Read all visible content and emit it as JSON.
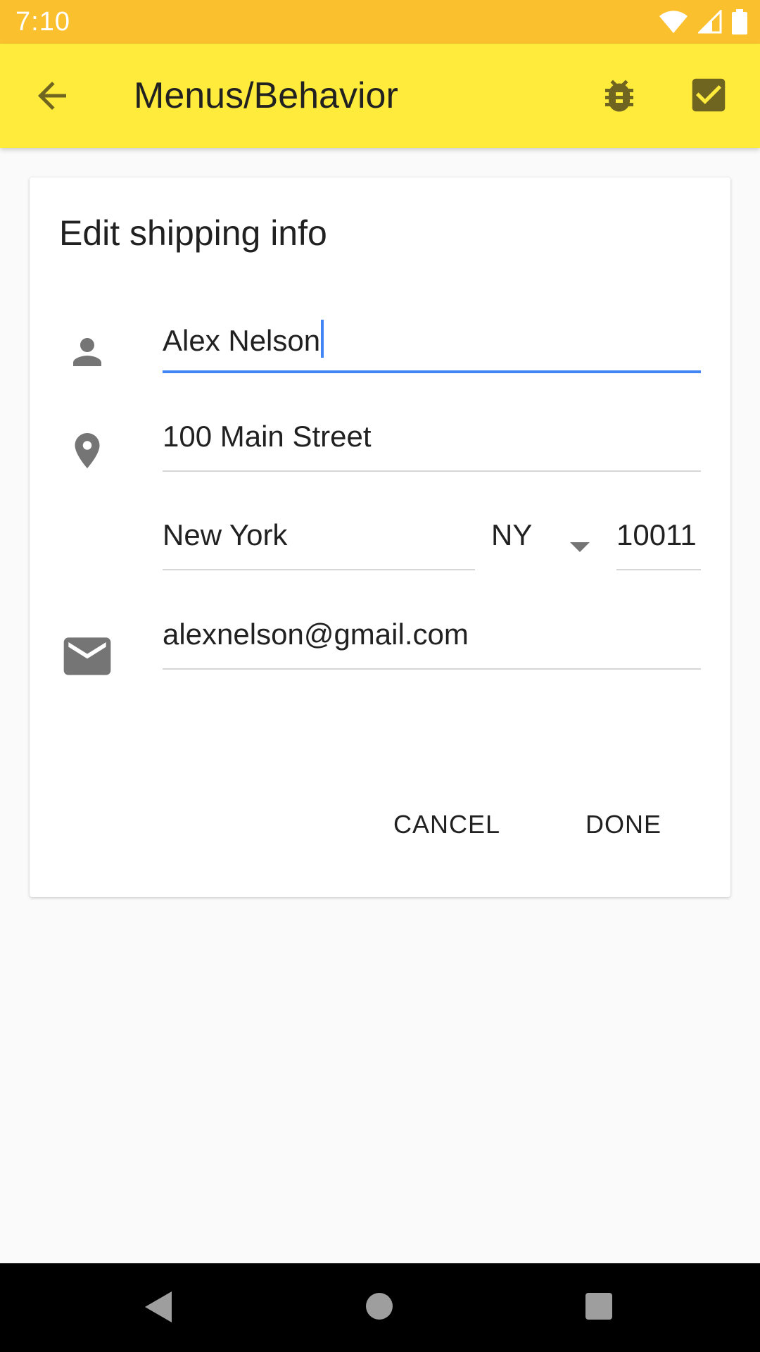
{
  "status_bar": {
    "time": "7:10",
    "icons": [
      "wifi-icon",
      "cell-signal-icon",
      "battery-icon"
    ]
  },
  "app_bar": {
    "title": "Menus/Behavior",
    "back_icon": "arrow-back-icon",
    "actions": [
      "bug-icon",
      "checkbox-checked-icon"
    ]
  },
  "dialog": {
    "title": "Edit shipping info",
    "name": {
      "value": "Alex Nelson",
      "icon": "person-icon"
    },
    "street": {
      "value": "100 Main Street",
      "icon": "location-pin-icon"
    },
    "city": {
      "value": "New York"
    },
    "state": {
      "value": "NY"
    },
    "zip": {
      "value": "10011"
    },
    "email": {
      "value": "alexnelson@gmail.com",
      "icon": "mail-icon"
    },
    "cancel_label": "CANCEL",
    "done_label": "DONE"
  },
  "nav_bar": {
    "icons": [
      "nav-back-icon",
      "nav-home-icon",
      "nav-recents-icon"
    ]
  },
  "colors": {
    "status_bar": "#fbc02d",
    "app_bar": "#ffeb3b",
    "focus_accent": "#4285f4",
    "icon_dark": "#6f6420"
  }
}
